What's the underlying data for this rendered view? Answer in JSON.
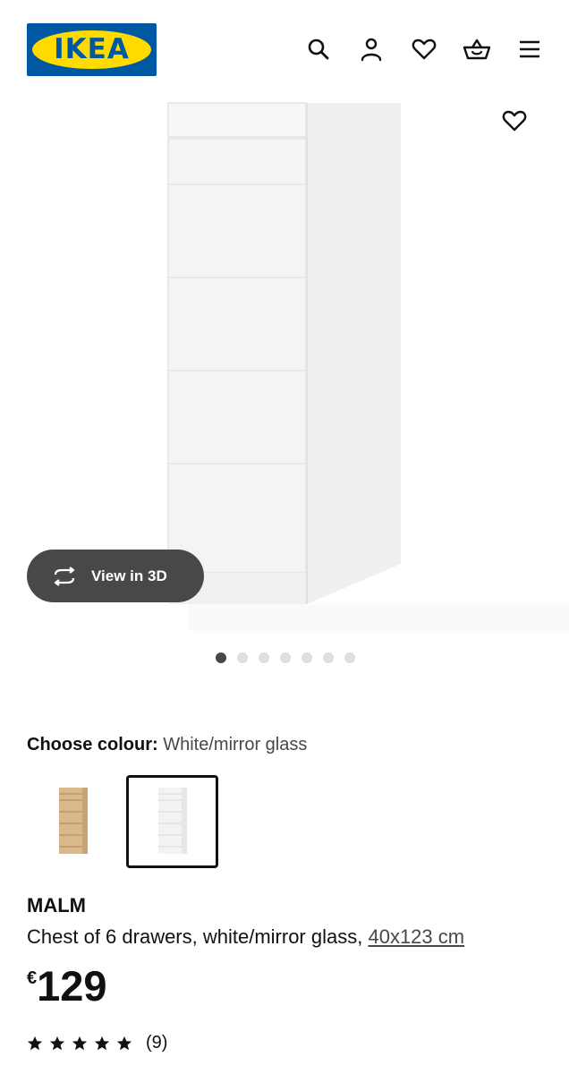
{
  "header": {
    "logo_text": "IKEA",
    "icons": [
      "search-icon",
      "account-icon",
      "heart-icon",
      "basket-icon",
      "menu-icon"
    ]
  },
  "media": {
    "view_3d_label": "View in 3D",
    "slide_count": 7,
    "active_slide": 1
  },
  "colour": {
    "label": "Choose colour:",
    "value": "White/mirror glass",
    "options": [
      "oak-effect",
      "white"
    ],
    "selected_index": 1
  },
  "product": {
    "name": "MALM",
    "description": "Chest of 6 drawers, white/mirror glass, ",
    "size": "40x123 cm",
    "currency": "€",
    "price": "129",
    "rating_stars": 5,
    "review_count": "(9)"
  },
  "colors": {
    "logo_blue": "#0058a3",
    "logo_yellow": "#ffdb00",
    "dark_button": "#484848"
  }
}
